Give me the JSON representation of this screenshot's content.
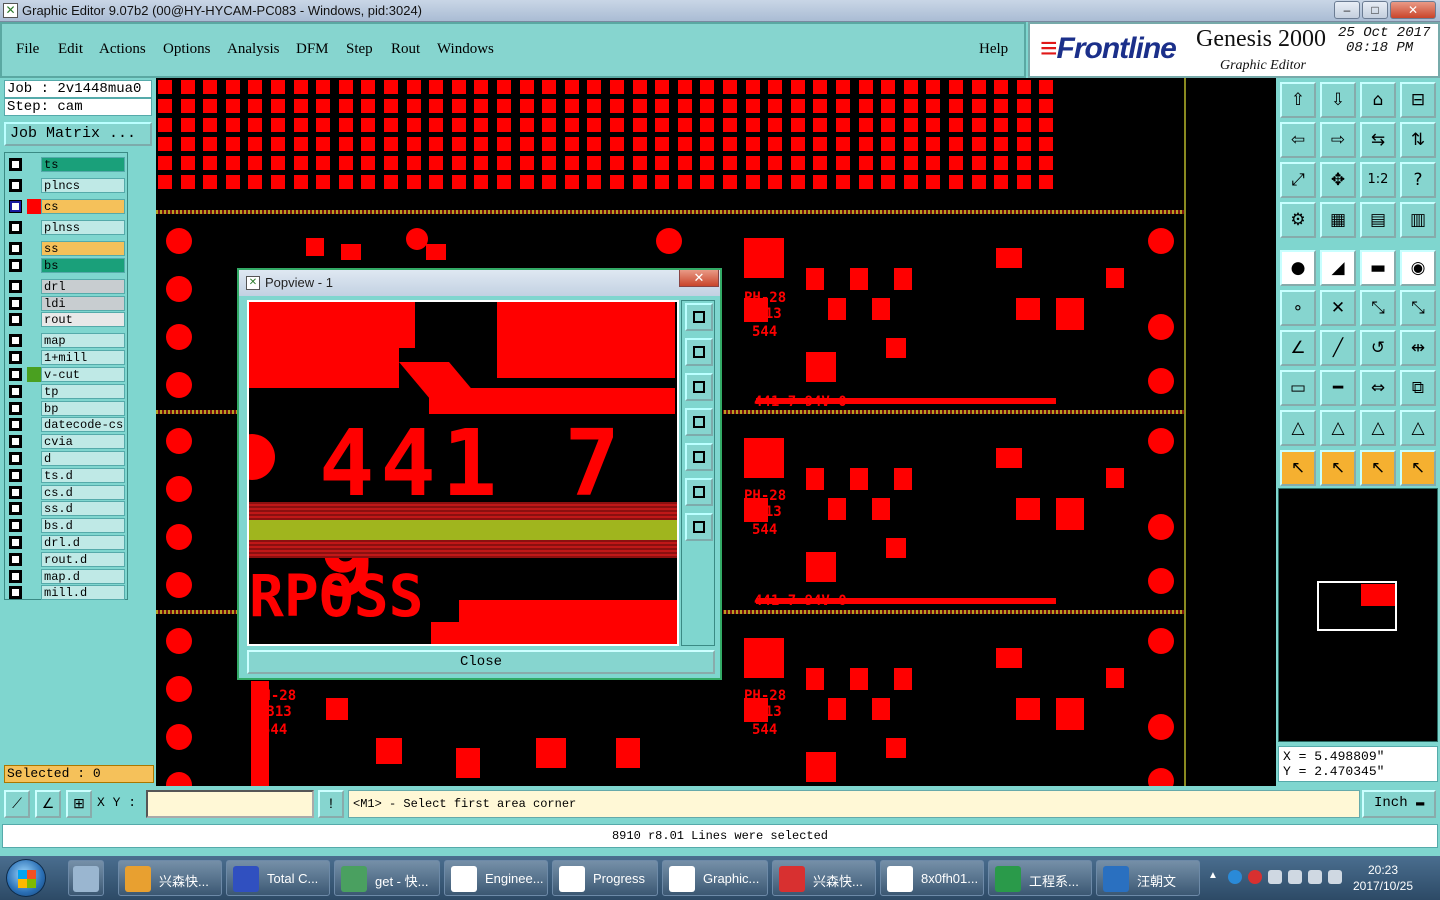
{
  "window": {
    "title": "Graphic Editor 9.07b2 (00@HY-HYCAM-PC083 - Windows, pid:3024)",
    "min": "–",
    "max": "□",
    "close": "✕"
  },
  "menu": {
    "items": [
      "File",
      "Edit",
      "Actions",
      "Options",
      "Analysis",
      "DFM",
      "Step",
      "Rout",
      "Windows"
    ],
    "help": "Help"
  },
  "logo": {
    "brand": "Frontline",
    "product": "Genesis 2000",
    "subtitle": "Graphic Editor",
    "date": "25 Oct 2017",
    "time": "08:18 PM"
  },
  "job": {
    "job_label": "Job : 2v1448mua0",
    "step_label": "Step: cam",
    "matrix_button": "Job Matrix ..."
  },
  "layers": [
    {
      "name": "ts",
      "color": "#1aa07a"
    },
    {
      "name": "plncs",
      "color": "#bfe9e6"
    },
    {
      "name": "cs",
      "color": "#f5c15a"
    },
    {
      "name": "plnss",
      "color": "#bfe9e6"
    },
    {
      "name": "ss",
      "color": "#f5c15a"
    },
    {
      "name": "bs",
      "color": "#1aa07a"
    },
    {
      "name": "drl",
      "color": "#c8cdd0"
    },
    {
      "name": "ldi",
      "color": "#c8cdd0"
    },
    {
      "name": "rout",
      "color": "#e8e8e8"
    },
    {
      "name": "map",
      "color": "#bfe9e6"
    },
    {
      "name": "1+mill",
      "color": "#bfe9e6"
    },
    {
      "name": "v-cut",
      "color": "#bfe9e6"
    },
    {
      "name": "tp",
      "color": "#bfe9e6"
    },
    {
      "name": "bp",
      "color": "#bfe9e6"
    },
    {
      "name": "datecode-cs",
      "color": "#bfe9e6"
    },
    {
      "name": "cvia",
      "color": "#bfe9e6"
    },
    {
      "name": "d",
      "color": "#bfe9e6"
    },
    {
      "name": "ts.d",
      "color": "#bfe9e6"
    },
    {
      "name": "cs.d",
      "color": "#bfe9e6"
    },
    {
      "name": "ss.d",
      "color": "#bfe9e6"
    },
    {
      "name": "bs.d",
      "color": "#bfe9e6"
    },
    {
      "name": "drl.d",
      "color": "#bfe9e6"
    },
    {
      "name": "rout.d",
      "color": "#bfe9e6"
    },
    {
      "name": "map.d",
      "color": "#bfe9e6"
    },
    {
      "name": "mill.d",
      "color": "#bfe9e6"
    }
  ],
  "selected_label": "Selected : 0",
  "pcb_text": {
    "marking": "PH-28",
    "code": "E313",
    "num": "544",
    "serial": "441 7 94V-0",
    "brand": "RPOSS"
  },
  "popview": {
    "title": "Popview - 1",
    "close_x": "✕",
    "close_button": "Close",
    "zoom_text": "441 7 9"
  },
  "coords": {
    "x": "X = 5.498809\"",
    "y": "Y = 2.470345\""
  },
  "bottom": {
    "xy_label": "X Y :",
    "xy_value": "",
    "prompt": "<M1> - Select first area corner",
    "unit": "Inch",
    "status": "8910 r8.01 Lines were selected"
  },
  "taskbar": {
    "tasks": [
      "兴森快...",
      "Total C...",
      "get - 快...",
      "Enginee...",
      "Progress",
      "Graphic...",
      "兴森快...",
      "8x0fh01...",
      "工程系...",
      "汪朝文"
    ],
    "time": "20:23",
    "date": "2017/10/25"
  },
  "colors": {
    "copper": "#ff0000",
    "panel": "#7fd6cf",
    "highlight": "#f5c15a"
  }
}
